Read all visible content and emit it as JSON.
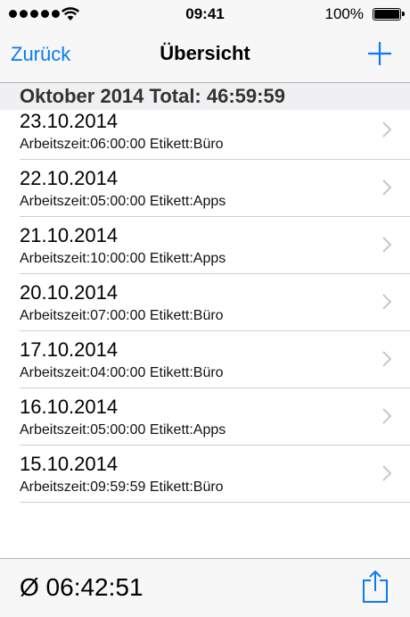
{
  "status_bar": {
    "time": "09:41",
    "battery": "100%"
  },
  "nav": {
    "back_label": "Zurück",
    "title": "Übersicht",
    "add_icon": "plus-icon"
  },
  "section": {
    "header": "Oktober 2014 Total: 46:59:59"
  },
  "entries": [
    {
      "date": "23.10.2014",
      "detail": "Arbeitszeit:06:00:00 Etikett:Büro"
    },
    {
      "date": "22.10.2014",
      "detail": "Arbeitszeit:05:00:00 Etikett:Apps"
    },
    {
      "date": "21.10.2014",
      "detail": "Arbeitszeit:10:00:00 Etikett:Apps"
    },
    {
      "date": "20.10.2014",
      "detail": "Arbeitszeit:07:00:00 Etikett:Büro"
    },
    {
      "date": "17.10.2014",
      "detail": "Arbeitszeit:04:00:00 Etikett:Büro"
    },
    {
      "date": "16.10.2014",
      "detail": "Arbeitszeit:05:00:00 Etikett:Apps"
    },
    {
      "date": "15.10.2014",
      "detail": "Arbeitszeit:09:59:59 Etikett:Büro"
    }
  ],
  "toolbar": {
    "average": "Ø 06:42:51",
    "share_icon": "share-icon"
  },
  "colors": {
    "accent": "#0a7af5",
    "chevron": "#c7c7cc"
  }
}
